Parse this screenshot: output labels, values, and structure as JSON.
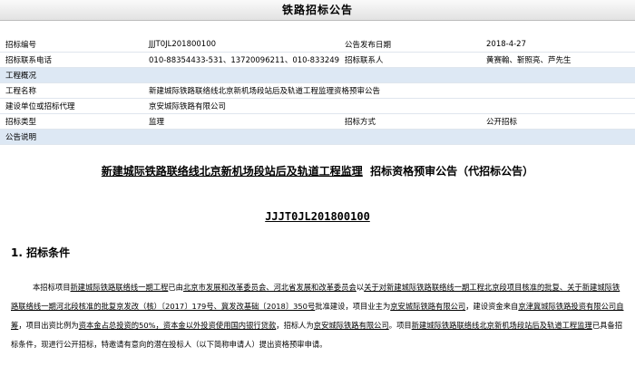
{
  "page_title": "铁路招标公告",
  "info": {
    "rows": [
      {
        "type": "pair",
        "l1": "招标编号",
        "v1": "JJJT0JL201800100",
        "l2": "公告发布日期",
        "v2": "2018-4-27"
      },
      {
        "type": "pair",
        "l1": "招标联系电话",
        "v1": "010-88354433-531、13720096211、010-83324922",
        "l2": "招标联系人",
        "v2": "黄赛翰、靳照亮、芦先生"
      },
      {
        "type": "section",
        "l1": "工程概况"
      },
      {
        "type": "full",
        "l1": "工程名称",
        "v1": "新建城际铁路联络线北京新机场段站后及轨道工程监理资格预审公告"
      },
      {
        "type": "full",
        "l1": "建设单位或招标代理",
        "v1": "京安城际铁路有限公司"
      },
      {
        "type": "pair",
        "l1": "招标类型",
        "v1": "监理",
        "l2": "招标方式",
        "v2": "公开招标"
      },
      {
        "type": "section",
        "l1": "公告说明"
      }
    ]
  },
  "doc": {
    "headline_underlined": "新建城际铁路联络线北京新机场段站后及轨道工程监理",
    "headline_rest": "招标资格预审公告（代招标公告）",
    "code": "JJJT0JL201800100",
    "section1": "1.  招标条件",
    "para": [
      {
        "t": "本招标项目",
        "u": false
      },
      {
        "t": "新建城际铁路联络线一期工程",
        "u": true
      },
      {
        "t": "已由",
        "u": false
      },
      {
        "t": "北京市发展和改革委员会、河北省发展和改革委员会",
        "u": true
      },
      {
        "t": "以",
        "u": false
      },
      {
        "t": "关于对新建城际铁路联络线一期工程北京段项目核准的批复、关于新建城际铁路联络线一期河北段核准的批复京发改（核）〔2017〕179号、冀发改基础〔2018〕350号",
        "u": true
      },
      {
        "t": "批准建设，项目业主为",
        "u": false
      },
      {
        "t": "京安城际铁路有限公司",
        "u": true
      },
      {
        "t": "，建设资金来自",
        "u": false
      },
      {
        "t": "京津冀城际铁路投资有限公司自筹",
        "u": true
      },
      {
        "t": "，项目出资比例为",
        "u": false
      },
      {
        "t": "资本金占总投资的50%，资本金以外投资使用国内银行贷款",
        "u": true
      },
      {
        "t": "，招标人为",
        "u": false
      },
      {
        "t": "京安城际铁路有限公司",
        "u": true
      },
      {
        "t": "。项目",
        "u": false
      },
      {
        "t": "新建城际铁路联络线北京新机场段站后及轨道工程监理",
        "u": true
      },
      {
        "t": "已具备招标条件，现进行公开招标，特邀请有意向的潜在投标人（以下简称申请人）提出资格预审申请。",
        "u": false
      }
    ]
  }
}
